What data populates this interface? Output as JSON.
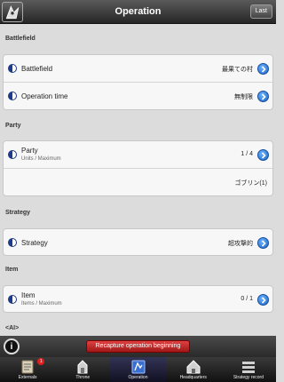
{
  "header": {
    "title": "Operation",
    "last_label": "Last"
  },
  "sections": {
    "battlefield": {
      "header": "Battlefield",
      "rows": [
        {
          "label": "Battlefield",
          "value": "最果ての村"
        },
        {
          "label": "Operation time",
          "value": "無制限"
        }
      ]
    },
    "party": {
      "header": "Party",
      "row": {
        "label": "Party",
        "sub": "Units / Maximum",
        "value": "1 / 4"
      },
      "member": "ゴブリン(1)"
    },
    "strategy": {
      "header": "Strategy",
      "row": {
        "label": "Strategy",
        "value": "超攻撃的"
      }
    },
    "item": {
      "header": "Item",
      "row": {
        "label": "Item",
        "sub": "Items / Maximum",
        "value": "0 / 1"
      }
    },
    "ai": {
      "header": "<AI>"
    }
  },
  "footer": {
    "info_label": "i",
    "recapture_label": "Recapture operation beginning"
  },
  "tabs": [
    {
      "label": "Externals",
      "icon": "scroll-icon",
      "badge": "1"
    },
    {
      "label": "Throne",
      "icon": "throne-icon"
    },
    {
      "label": "Operation",
      "icon": "map-icon"
    },
    {
      "label": "Headquarters",
      "icon": "castle-icon"
    },
    {
      "label": "Strategy record",
      "icon": "list-icon"
    }
  ]
}
